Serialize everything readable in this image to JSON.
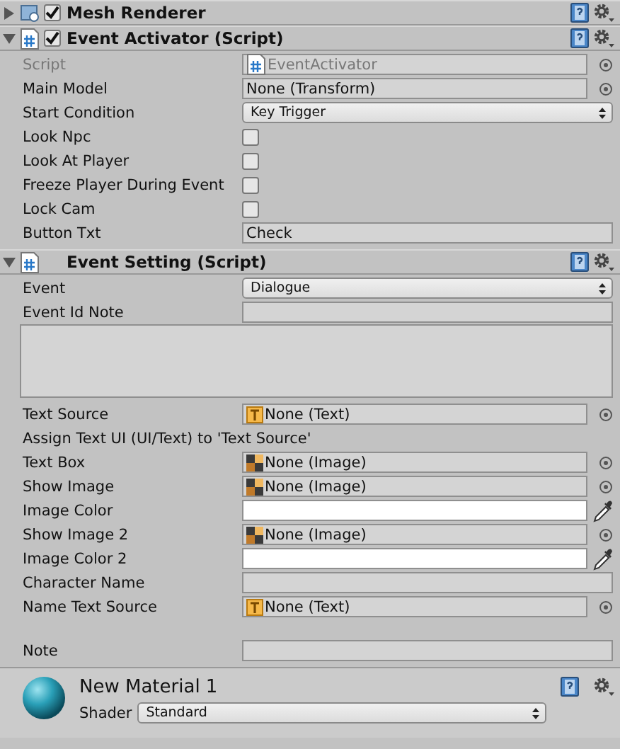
{
  "components": [
    {
      "title": "Mesh Renderer",
      "kind": "renderer",
      "expanded": false,
      "enabled": true
    },
    {
      "title": "Event Activator (Script)",
      "kind": "script",
      "expanded": true,
      "enabled": true,
      "fields": [
        {
          "label": "Script",
          "kind": "script-ref",
          "value": "EventActivator"
        },
        {
          "label": "Main Model",
          "kind": "object-plain",
          "value": "None (Transform)"
        },
        {
          "label": "Start Condition",
          "kind": "dropdown",
          "value": "Key Trigger"
        },
        {
          "label": "Look Npc",
          "kind": "checkbox",
          "checked": false
        },
        {
          "label": "Look At Player",
          "kind": "checkbox",
          "checked": false
        },
        {
          "label": "Freeze Player During Event",
          "kind": "checkbox",
          "checked": false
        },
        {
          "label": "Lock Cam",
          "kind": "checkbox",
          "checked": false
        },
        {
          "label": "Button Txt",
          "kind": "text",
          "value": "Check"
        }
      ]
    },
    {
      "title": "Event Setting (Script)",
      "kind": "script",
      "expanded": true,
      "fields": [
        {
          "label": "Event",
          "kind": "dropdown",
          "value": "Dialogue"
        },
        {
          "label": "Event Id Note",
          "kind": "text"
        },
        {
          "kind": "textarea"
        },
        {
          "label": "Text Source",
          "kind": "object-text",
          "value": "None (Text)"
        },
        {
          "label": "Assign Text UI (UI/Text) to 'Text Source'",
          "kind": "info"
        },
        {
          "label": "Text Box",
          "kind": "object-image",
          "value": "None (Image)"
        },
        {
          "label": "Show Image",
          "kind": "object-image",
          "value": "None (Image)"
        },
        {
          "label": "Image Color",
          "kind": "color",
          "color": "#ffffff"
        },
        {
          "label": "Show Image 2",
          "kind": "object-image",
          "value": "None (Image)"
        },
        {
          "label": "Image Color 2",
          "kind": "color",
          "color": "#ffffff"
        },
        {
          "label": "Character Name",
          "kind": "text"
        },
        {
          "label": "Name Text Source",
          "kind": "object-text",
          "value": "None (Text)"
        },
        {
          "label": "Note",
          "kind": "text",
          "gap_before": true
        }
      ]
    }
  ],
  "material": {
    "name": "New Material 1",
    "shader_label": "Shader",
    "shader": "Standard"
  }
}
